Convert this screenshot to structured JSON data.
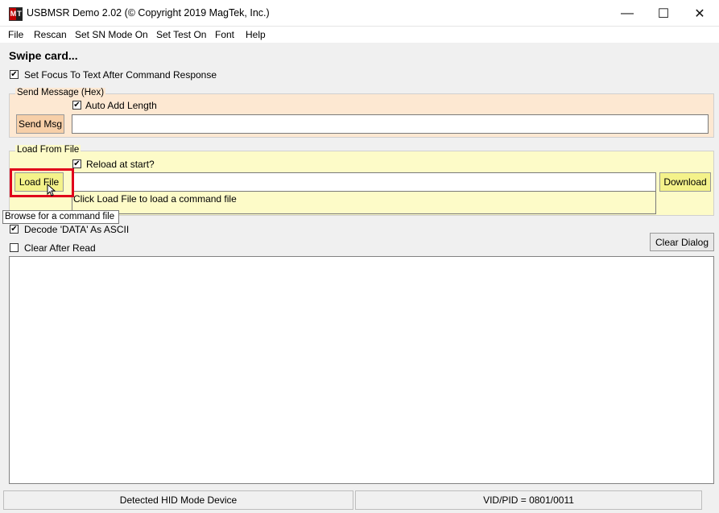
{
  "window": {
    "title": "USBMSR Demo 2.02 (© Copyright 2019 MagTek, Inc.)",
    "icon_letters": [
      "M",
      "T"
    ],
    "controls": {
      "minimize": "—",
      "maximize": "☐",
      "close": "✕"
    }
  },
  "menu": [
    "File",
    "Rescan",
    "Set SN Mode On",
    "Set Test On",
    "Font",
    "Help"
  ],
  "status_prompt": "Swipe card...",
  "focus_option": {
    "label": "Set Focus To Text After Command Response",
    "checked": true
  },
  "send_message": {
    "group_title": "Send Message (Hex)",
    "auto_add_length": {
      "label": "Auto Add Length",
      "checked": true
    },
    "button": "Send Msg",
    "input_value": ""
  },
  "load_from_file": {
    "group_title": "Load From File",
    "reload_at_start": {
      "label": "Reload at start?",
      "checked": true
    },
    "load_button": "Load File",
    "file_path": "",
    "hint": "Click Load File to load a command file",
    "download_button": "Download"
  },
  "tooltip": "Browse for a command file",
  "decode_option": {
    "label": "Decode 'DATA' As ASCII",
    "checked": true
  },
  "clear_after_read": {
    "label": "Clear After Read",
    "checked": false
  },
  "clear_dialog_button": "Clear Dialog",
  "output_text": "",
  "statusbar": {
    "device": "Detected HID Mode Device",
    "vid_pid": "VID/PID = 0801/0011"
  },
  "colors": {
    "send_group_bg": "#fde8d2",
    "send_button_bg": "#f7cfa8",
    "load_group_bg": "#fdfbc8",
    "load_button_bg": "#f4f28a",
    "highlight": "#e0001b"
  }
}
